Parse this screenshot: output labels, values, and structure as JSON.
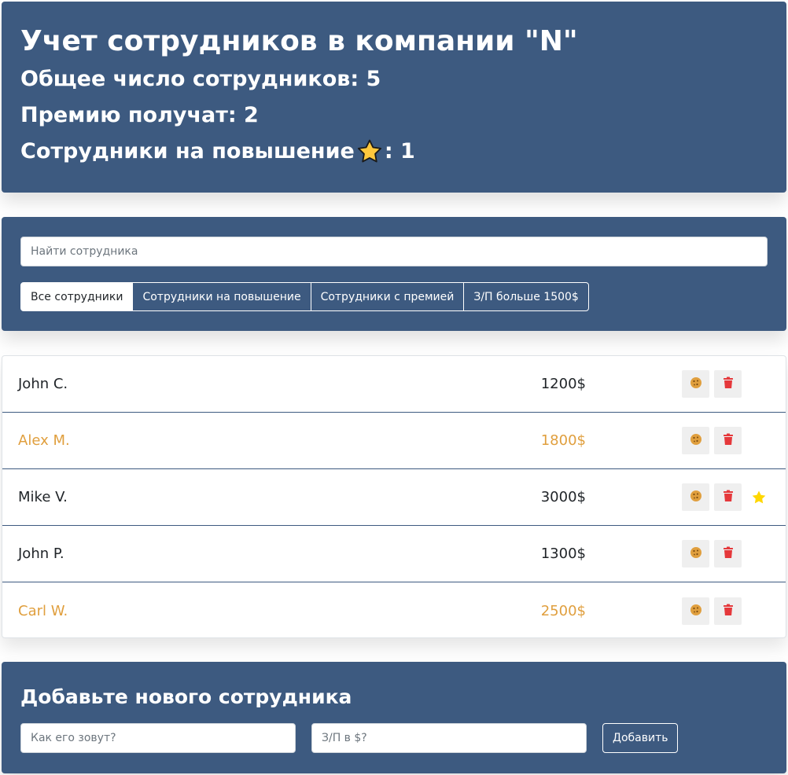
{
  "app_info": {
    "title": "Учет сотрудников в компании \"N\"",
    "total_label": "Общее число сотрудников: 5",
    "bonus_label": "Премию получат: 2",
    "promotion_label_prefix": "Сотрудники на повышение",
    "promotion_label_suffix": ": 1"
  },
  "search": {
    "placeholder": "Найти сотрудника"
  },
  "filters": [
    {
      "label": "Все сотрудники",
      "active": true
    },
    {
      "label": "Сотрудники на повышение",
      "active": false
    },
    {
      "label": "Сотрудники с премией",
      "active": false
    },
    {
      "label": "З/П больше 1500$",
      "active": false
    }
  ],
  "employees": [
    {
      "name": "John C.",
      "salary": "1200$",
      "increase": false,
      "rise": false
    },
    {
      "name": "Alex M.",
      "salary": "1800$",
      "increase": true,
      "rise": false
    },
    {
      "name": "Mike V.",
      "salary": "3000$",
      "increase": false,
      "rise": true
    },
    {
      "name": "John P.",
      "salary": "1300$",
      "increase": false,
      "rise": false
    },
    {
      "name": "Carl W.",
      "salary": "2500$",
      "increase": true,
      "rise": false
    }
  ],
  "add_form": {
    "title": "Добавьте нового сотрудника",
    "name_placeholder": "Как его зовут?",
    "salary_placeholder": "З/П в $?",
    "submit_label": "Добавить"
  },
  "colors": {
    "panel": "#3d5a80",
    "increase_text": "#e09f3e",
    "delete_icon": "#e5383b",
    "star": "#ffd700"
  }
}
